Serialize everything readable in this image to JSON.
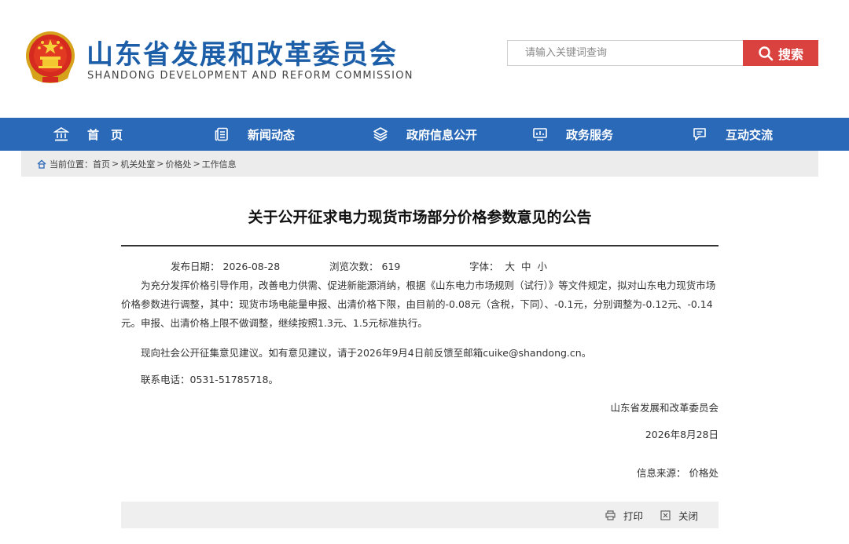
{
  "header": {
    "title": "山东省发展和改革委员会",
    "subtitle": "SHANDONG DEVELOPMENT AND REFORM COMMISSION",
    "search_placeholder": "请输入关键词查询",
    "search_label": "搜索"
  },
  "colors": {
    "brand_blue": "#2a69b8",
    "title_blue": "#1c5ea8",
    "search_red": "#d9423f"
  },
  "nav": {
    "items": [
      {
        "label": "首　页",
        "icon": "home-icon"
      },
      {
        "label": "新闻动态",
        "icon": "news-icon"
      },
      {
        "label": "政府信息公开",
        "icon": "layers-icon"
      },
      {
        "label": "政务服务",
        "icon": "monitor-chart-icon"
      },
      {
        "label": "互动交流",
        "icon": "chat-icon"
      }
    ]
  },
  "breadcrumb": {
    "prefix": "当前位置：",
    "items": [
      "首页",
      "机关处室",
      "价格处",
      "工作信息"
    ]
  },
  "article": {
    "title": "关于公开征求电力现货市场部分价格参数意见的公告",
    "meta": {
      "date_label": "发布日期：",
      "date": "2026-08-28",
      "views_label": "浏览次数：",
      "views": "619",
      "font_label": "字体：",
      "font_sizes": [
        "大",
        "中",
        "小"
      ]
    },
    "paragraphs": [
      "为充分发挥价格引导作用，改善电力供需、促进新能源消纳，根据《山东电力市场规则（试行）》等文件规定，拟对山东电力现货市场价格参数进行调整，其中：现货市场电能量申报、出清价格下限，由目前的-0.08元（含税，下同）、-0.1元，分别调整为-0.12元、-0.14元。申报、出清价格上限不做调整，继续按照1.3元、1.5元标准执行。",
      "现向社会公开征集意见建议。如有意见建议，请于2026年9月4日前反馈至邮箱cuike@shandong.cn。",
      "联系电话：0531-51785718。"
    ],
    "signature": "山东省发展和改革委员会",
    "sign_date": "2026年8月28日",
    "source_label": "信息来源：",
    "source": "价格处"
  },
  "footer": {
    "print_label": "打印",
    "close_label": "关闭"
  }
}
